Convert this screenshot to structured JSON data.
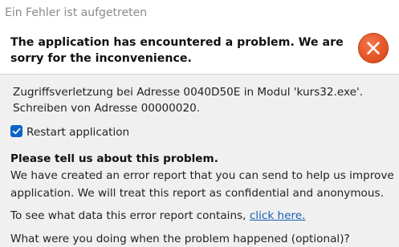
{
  "window": {
    "title": "Ein Fehler ist aufgetreten"
  },
  "header": {
    "message": "The application has encountered a problem. We are sorry for the inconvenience.",
    "icon": "error-close-icon",
    "icon_color": "#e45527"
  },
  "error": {
    "line1": "Zugriffsverletzung bei Adresse 0040D50E in Modul 'kurs32.exe'.",
    "line2": "Schreiben von Adresse 00000020."
  },
  "restart": {
    "label": "Restart application",
    "checked": true,
    "accent": "#0a64c8"
  },
  "feedback": {
    "title": "Please tell us about this problem.",
    "body": "We have created an error report that you can send to help us improve application. We will treat this report as confidential and anonymous.",
    "see_text": "To see what data this error report contains,",
    "link_label": "click here.",
    "question": "What were you doing when the problem happened (optional)?"
  }
}
